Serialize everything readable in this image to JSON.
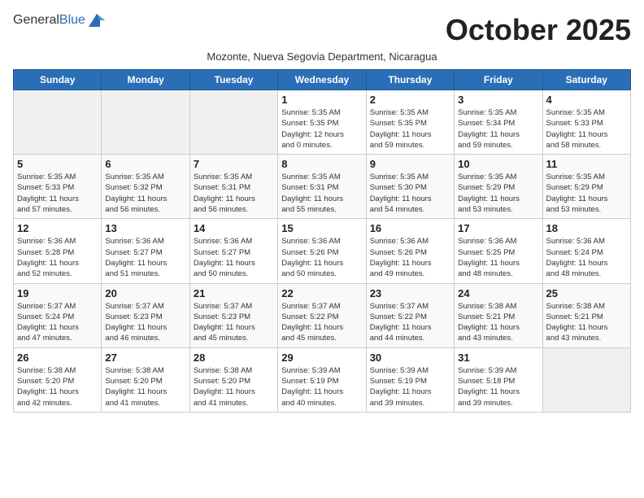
{
  "header": {
    "logo_general": "General",
    "logo_blue": "Blue",
    "title": "October 2025",
    "subtitle": "Mozonte, Nueva Segovia Department, Nicaragua"
  },
  "weekdays": [
    "Sunday",
    "Monday",
    "Tuesday",
    "Wednesday",
    "Thursday",
    "Friday",
    "Saturday"
  ],
  "weeks": [
    [
      {
        "day": "",
        "info": ""
      },
      {
        "day": "",
        "info": ""
      },
      {
        "day": "",
        "info": ""
      },
      {
        "day": "1",
        "info": "Sunrise: 5:35 AM\nSunset: 5:35 PM\nDaylight: 12 hours\nand 0 minutes."
      },
      {
        "day": "2",
        "info": "Sunrise: 5:35 AM\nSunset: 5:35 PM\nDaylight: 11 hours\nand 59 minutes."
      },
      {
        "day": "3",
        "info": "Sunrise: 5:35 AM\nSunset: 5:34 PM\nDaylight: 11 hours\nand 59 minutes."
      },
      {
        "day": "4",
        "info": "Sunrise: 5:35 AM\nSunset: 5:33 PM\nDaylight: 11 hours\nand 58 minutes."
      }
    ],
    [
      {
        "day": "5",
        "info": "Sunrise: 5:35 AM\nSunset: 5:33 PM\nDaylight: 11 hours\nand 57 minutes."
      },
      {
        "day": "6",
        "info": "Sunrise: 5:35 AM\nSunset: 5:32 PM\nDaylight: 11 hours\nand 56 minutes."
      },
      {
        "day": "7",
        "info": "Sunrise: 5:35 AM\nSunset: 5:31 PM\nDaylight: 11 hours\nand 56 minutes."
      },
      {
        "day": "8",
        "info": "Sunrise: 5:35 AM\nSunset: 5:31 PM\nDaylight: 11 hours\nand 55 minutes."
      },
      {
        "day": "9",
        "info": "Sunrise: 5:35 AM\nSunset: 5:30 PM\nDaylight: 11 hours\nand 54 minutes."
      },
      {
        "day": "10",
        "info": "Sunrise: 5:35 AM\nSunset: 5:29 PM\nDaylight: 11 hours\nand 53 minutes."
      },
      {
        "day": "11",
        "info": "Sunrise: 5:35 AM\nSunset: 5:29 PM\nDaylight: 11 hours\nand 53 minutes."
      }
    ],
    [
      {
        "day": "12",
        "info": "Sunrise: 5:36 AM\nSunset: 5:28 PM\nDaylight: 11 hours\nand 52 minutes."
      },
      {
        "day": "13",
        "info": "Sunrise: 5:36 AM\nSunset: 5:27 PM\nDaylight: 11 hours\nand 51 minutes."
      },
      {
        "day": "14",
        "info": "Sunrise: 5:36 AM\nSunset: 5:27 PM\nDaylight: 11 hours\nand 50 minutes."
      },
      {
        "day": "15",
        "info": "Sunrise: 5:36 AM\nSunset: 5:26 PM\nDaylight: 11 hours\nand 50 minutes."
      },
      {
        "day": "16",
        "info": "Sunrise: 5:36 AM\nSunset: 5:26 PM\nDaylight: 11 hours\nand 49 minutes."
      },
      {
        "day": "17",
        "info": "Sunrise: 5:36 AM\nSunset: 5:25 PM\nDaylight: 11 hours\nand 48 minutes."
      },
      {
        "day": "18",
        "info": "Sunrise: 5:36 AM\nSunset: 5:24 PM\nDaylight: 11 hours\nand 48 minutes."
      }
    ],
    [
      {
        "day": "19",
        "info": "Sunrise: 5:37 AM\nSunset: 5:24 PM\nDaylight: 11 hours\nand 47 minutes."
      },
      {
        "day": "20",
        "info": "Sunrise: 5:37 AM\nSunset: 5:23 PM\nDaylight: 11 hours\nand 46 minutes."
      },
      {
        "day": "21",
        "info": "Sunrise: 5:37 AM\nSunset: 5:23 PM\nDaylight: 11 hours\nand 45 minutes."
      },
      {
        "day": "22",
        "info": "Sunrise: 5:37 AM\nSunset: 5:22 PM\nDaylight: 11 hours\nand 45 minutes."
      },
      {
        "day": "23",
        "info": "Sunrise: 5:37 AM\nSunset: 5:22 PM\nDaylight: 11 hours\nand 44 minutes."
      },
      {
        "day": "24",
        "info": "Sunrise: 5:38 AM\nSunset: 5:21 PM\nDaylight: 11 hours\nand 43 minutes."
      },
      {
        "day": "25",
        "info": "Sunrise: 5:38 AM\nSunset: 5:21 PM\nDaylight: 11 hours\nand 43 minutes."
      }
    ],
    [
      {
        "day": "26",
        "info": "Sunrise: 5:38 AM\nSunset: 5:20 PM\nDaylight: 11 hours\nand 42 minutes."
      },
      {
        "day": "27",
        "info": "Sunrise: 5:38 AM\nSunset: 5:20 PM\nDaylight: 11 hours\nand 41 minutes."
      },
      {
        "day": "28",
        "info": "Sunrise: 5:38 AM\nSunset: 5:20 PM\nDaylight: 11 hours\nand 41 minutes."
      },
      {
        "day": "29",
        "info": "Sunrise: 5:39 AM\nSunset: 5:19 PM\nDaylight: 11 hours\nand 40 minutes."
      },
      {
        "day": "30",
        "info": "Sunrise: 5:39 AM\nSunset: 5:19 PM\nDaylight: 11 hours\nand 39 minutes."
      },
      {
        "day": "31",
        "info": "Sunrise: 5:39 AM\nSunset: 5:18 PM\nDaylight: 11 hours\nand 39 minutes."
      },
      {
        "day": "",
        "info": ""
      }
    ]
  ]
}
